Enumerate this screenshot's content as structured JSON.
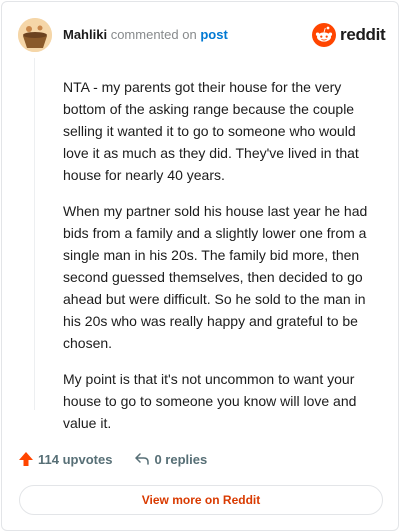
{
  "header": {
    "username": "Mahliki",
    "action_text": "commented on",
    "post_link": "post"
  },
  "brand": {
    "logo_icon": "reddit-snoo-icon",
    "wordmark": "reddit",
    "accent_color": "#ff4500"
  },
  "comment": {
    "paragraphs": [
      "NTA - my parents got their house for the very bottom of the asking range because the couple selling it wanted it to go to someone who would love it as much as they did. They've lived in that house for nearly 40 years.",
      "When my partner sold his house last year he had bids from a family and a slightly lower one from a single man in his 20s. The family bid more, then second guessed themselves, then decided to go ahead but were difficult. So he sold to the man in his 20s who was really happy and grateful to be chosen.",
      "My point is that it's not uncommon to want your house to go to someone you know will love and value it."
    ]
  },
  "actions": {
    "upvotes": "114 upvotes",
    "replies": "0 replies"
  },
  "footer": {
    "view_more": "View more on Reddit",
    "link_color": "#d93a00"
  }
}
